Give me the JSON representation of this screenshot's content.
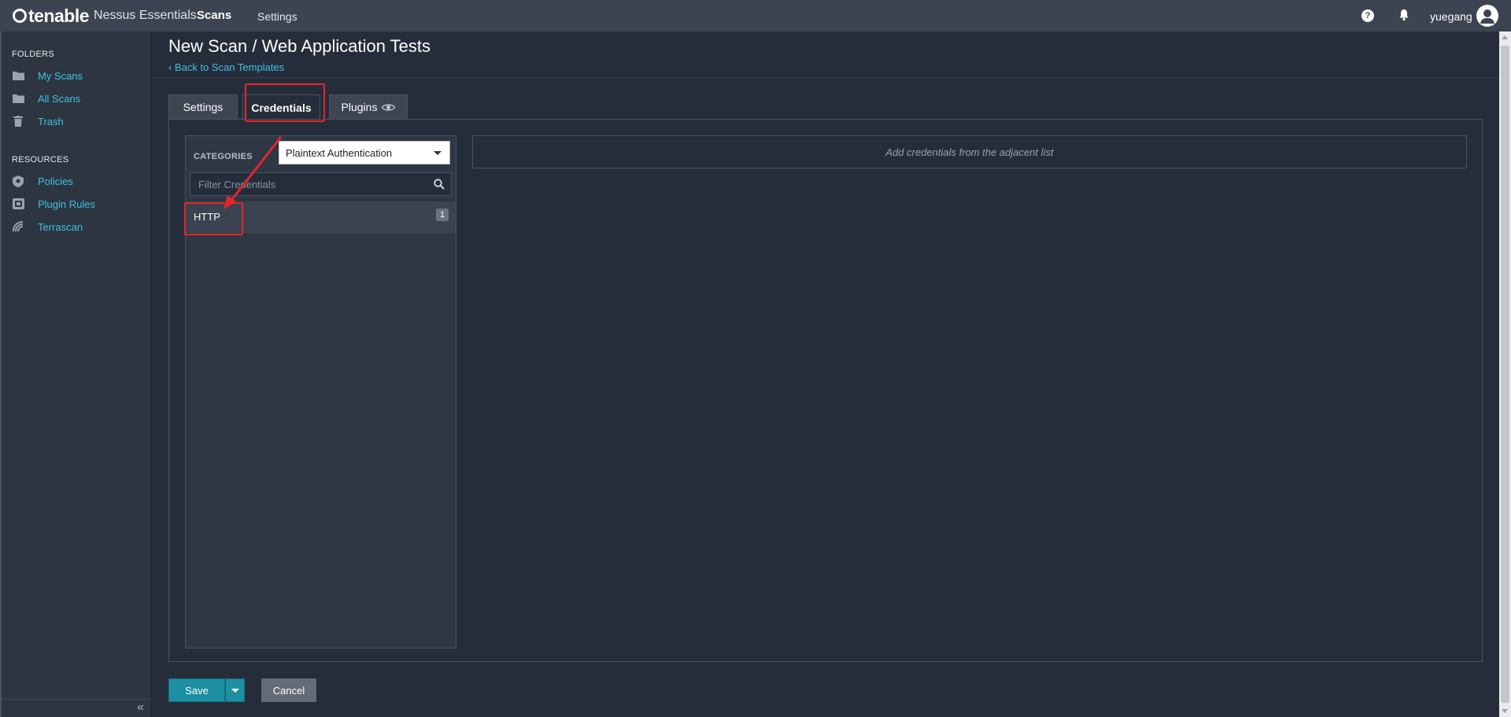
{
  "topbar": {
    "brand": "tenable",
    "product": "Nessus Essentials",
    "nav_scans": "Scans",
    "nav_settings": "Settings",
    "help_symbol": "?",
    "username": "yuegang"
  },
  "sidebar": {
    "folders_heading": "FOLDERS",
    "folders": [
      {
        "label": "My Scans",
        "icon": "folder-icon"
      },
      {
        "label": "All Scans",
        "icon": "folder-icon"
      },
      {
        "label": "Trash",
        "icon": "trash-icon"
      }
    ],
    "resources_heading": "RESOURCES",
    "resources": [
      {
        "label": "Policies",
        "icon": "policy-shield-icon"
      },
      {
        "label": "Plugin Rules",
        "icon": "plugin-rules-icon"
      },
      {
        "label": "Terrascan",
        "icon": "terrascan-icon"
      }
    ],
    "collapse_symbol": "«"
  },
  "page": {
    "title": "New Scan / Web Application Tests",
    "back_link": "‹ Back to Scan Templates"
  },
  "tabs": [
    {
      "label": "Settings",
      "active": false
    },
    {
      "label": "Credentials",
      "active": true
    },
    {
      "label": "Plugins",
      "active": false,
      "icon": "eye-icon"
    }
  ],
  "credentials": {
    "categories_label": "CATEGORIES",
    "category_selected": "Plaintext Authentication",
    "filter_placeholder": "Filter Credentials",
    "items": [
      {
        "name": "HTTP",
        "count": "1"
      }
    ],
    "empty_message": "Add credentials from the adjacent list"
  },
  "actions": {
    "save": "Save",
    "cancel": "Cancel"
  },
  "colors": {
    "accent": "#3fc1e0",
    "save_button": "#1c8fa3",
    "annotation_red": "#e3262a",
    "background": "#252d3a"
  }
}
